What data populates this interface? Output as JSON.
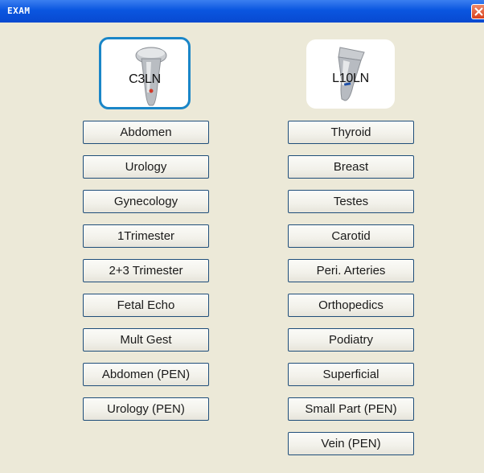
{
  "window": {
    "title": "EXAM"
  },
  "probes": {
    "left": {
      "label": "C3LN",
      "selected": true
    },
    "right": {
      "label": "L10LN",
      "selected": false
    }
  },
  "colors": {
    "title_bar": "#0a56e0",
    "selection_border": "#1a86c8",
    "background": "#ece9d8",
    "close": "#d8401c"
  },
  "exams_left": [
    "Abdomen",
    "Urology",
    "Gynecology",
    "1Trimester",
    "2+3 Trimester",
    "Fetal Echo",
    "Mult Gest",
    "Abdomen (PEN)",
    "Urology (PEN)"
  ],
  "exams_right": [
    "Thyroid",
    "Breast",
    "Testes",
    "Carotid",
    "Peri. Arteries",
    "Orthopedics",
    "Podiatry",
    "Superficial",
    "Small Part (PEN)",
    "Vein (PEN)"
  ]
}
